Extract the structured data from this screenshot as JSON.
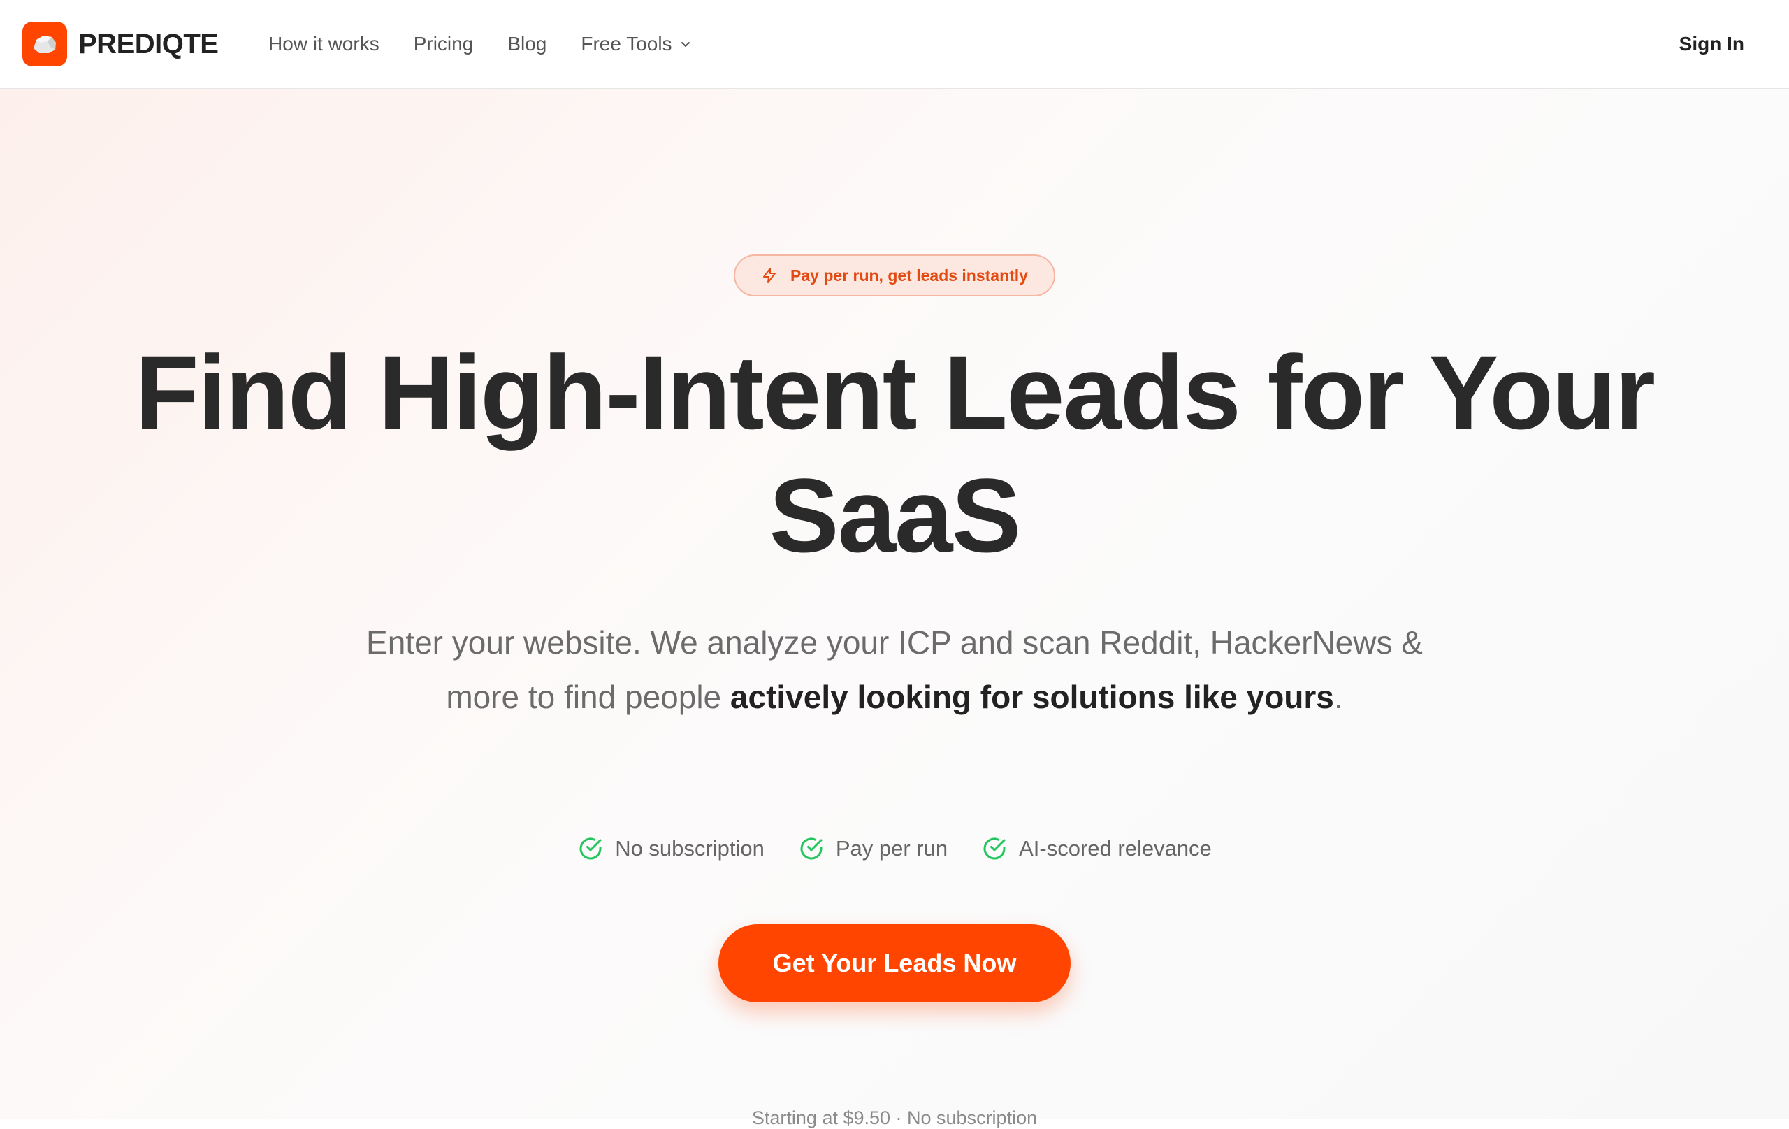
{
  "brand": {
    "name": "PREDIQTE",
    "logo_icon": "rock-icon",
    "accent_color": "#ff4500"
  },
  "nav": {
    "items": [
      {
        "label": "How it works"
      },
      {
        "label": "Pricing"
      },
      {
        "label": "Blog"
      },
      {
        "label": "Free Tools",
        "has_dropdown": true,
        "icon": "chevron-down-icon"
      }
    ],
    "sign_in": "Sign In"
  },
  "hero": {
    "badge": {
      "icon": "lightning-icon",
      "text": "Pay per run, get leads instantly"
    },
    "headline": "Find High-Intent Leads for Your SaaS",
    "subtext_plain": "Enter your website. We analyze your ICP and scan Reddit, HackerNews & more to find people ",
    "subtext_strong": "actively looking for solutions like yours",
    "subtext_end": ".",
    "features": [
      {
        "icon": "check-circle-icon",
        "label": "No subscription"
      },
      {
        "icon": "check-circle-icon",
        "label": "Pay per run"
      },
      {
        "icon": "check-circle-icon",
        "label": "AI-scored relevance"
      }
    ],
    "feature_color": "#22c55e",
    "cta_label": "Get Your Leads Now",
    "pricing_note": "Starting at $9.50 · No subscription"
  }
}
